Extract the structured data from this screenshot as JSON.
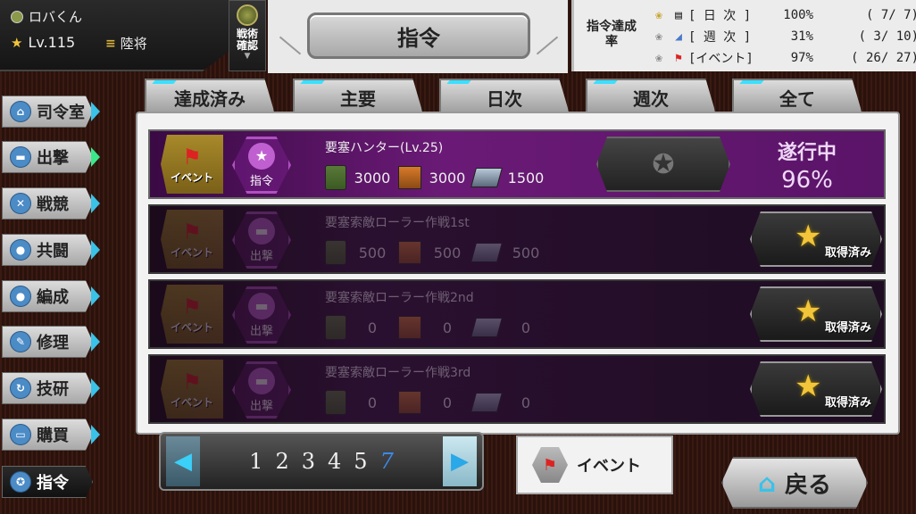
{
  "profile": {
    "name": "ロバくん",
    "level": "Lv.115",
    "rank": "陸将"
  },
  "tactics_label": "戦術確認",
  "title": "指令",
  "rates": {
    "header": "指令達成率",
    "rows": [
      {
        "kind": "[ 日 次 ]",
        "pct": "100%",
        "frac": "(  7/  7)"
      },
      {
        "kind": "[ 週 次 ]",
        "pct": "31%",
        "frac": "(  3/ 10)"
      },
      {
        "kind": "[イベント]",
        "pct": "97%",
        "frac": "( 26/ 27)"
      }
    ]
  },
  "sidebar": [
    {
      "label": "司令室",
      "icon": "⌂"
    },
    {
      "label": "出撃",
      "icon": "▬"
    },
    {
      "label": "戦競",
      "icon": "✕"
    },
    {
      "label": "共闘",
      "icon": "●"
    },
    {
      "label": "編成",
      "icon": "●"
    },
    {
      "label": "修理",
      "icon": "✎"
    },
    {
      "label": "技研",
      "icon": "↻"
    },
    {
      "label": "購買",
      "icon": "▭"
    },
    {
      "label": "指令",
      "icon": "✪"
    }
  ],
  "tabs": [
    "達成済み",
    "主要",
    "日次",
    "週次",
    "全て"
  ],
  "missions": [
    {
      "category": "イベント",
      "type": "指令",
      "title": "要塞ハンター(Lv.25)",
      "fuel": "3000",
      "ammo": "3000",
      "steel": "1500",
      "status": "遂行中",
      "progress": "96%"
    },
    {
      "category": "イベント",
      "type": "出撃",
      "title": "要塞索敵ローラー作戦1st",
      "fuel": "500",
      "ammo": "500",
      "steel": "500",
      "status": "取得済み"
    },
    {
      "category": "イベント",
      "type": "出撃",
      "title": "要塞索敵ローラー作戦2nd",
      "fuel": "0",
      "ammo": "0",
      "steel": "0",
      "status": "取得済み"
    },
    {
      "category": "イベント",
      "type": "出撃",
      "title": "要塞索敵ローラー作戦3rd",
      "fuel": "0",
      "ammo": "0",
      "steel": "0",
      "status": "取得済み"
    }
  ],
  "pager": {
    "pages": [
      "1",
      "2",
      "3",
      "4",
      "5",
      "7"
    ],
    "current": "7"
  },
  "event_button": "イベント",
  "back_button": "戻る"
}
